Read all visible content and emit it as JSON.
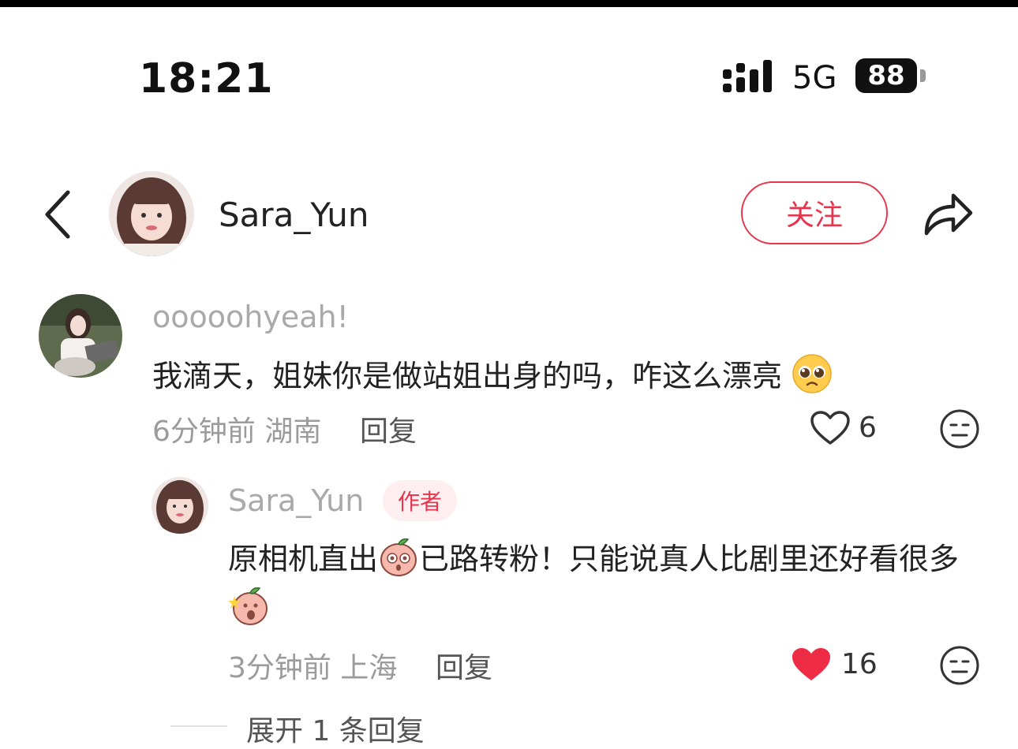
{
  "status_bar": {
    "time": "18:21",
    "network": "5G",
    "battery": "88"
  },
  "header": {
    "username": "Sara_Yun",
    "follow_label": "关注"
  },
  "comment": {
    "author": "ooooohyeah!",
    "text": "我滴天，姐妹你是做站姐出身的吗，咋这么漂亮",
    "emoji": "pleading-face-emoji",
    "time": "6分钟前",
    "location": "湖南",
    "reply_label": "回复",
    "likes": "6"
  },
  "reply": {
    "author": "Sara_Yun",
    "badge": "作者",
    "text_part1": "原相机直出",
    "text_part2": "已路转粉！只能说真人比剧里还好看很多",
    "time": "3分钟前",
    "location": "上海",
    "reply_label": "回复",
    "likes": "16",
    "liked": true,
    "like_color": "#ee2c45"
  },
  "expand_label": "展开 1 条回复",
  "colors": {
    "accent": "#e6354d",
    "muted": "#a9a9a9"
  }
}
